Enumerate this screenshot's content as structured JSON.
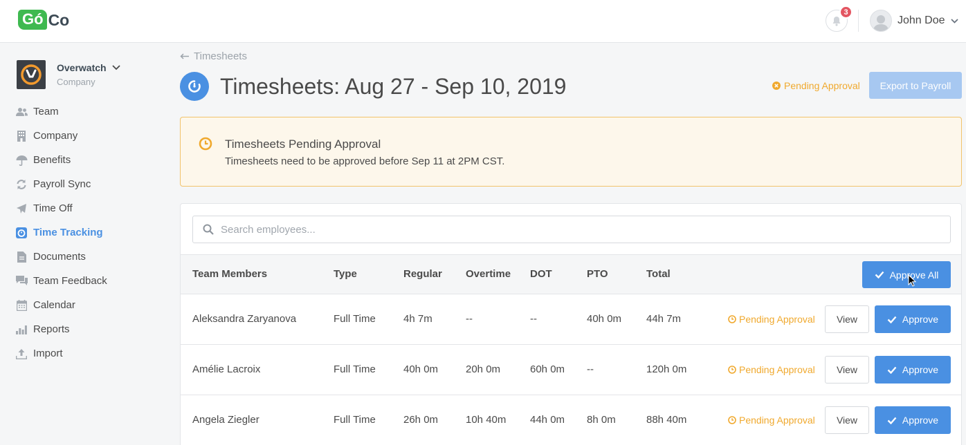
{
  "app": {
    "logo_go": "Gó",
    "logo_co": "Co",
    "notifications_count": "3",
    "user_name": "John Doe"
  },
  "org": {
    "name": "Overwatch",
    "subtitle": "Company"
  },
  "nav": [
    {
      "label": "Team",
      "icon": "team-icon",
      "active": false
    },
    {
      "label": "Company",
      "icon": "building-icon",
      "active": false
    },
    {
      "label": "Benefits",
      "icon": "umbrella-icon",
      "active": false
    },
    {
      "label": "Payroll Sync",
      "icon": "sync-icon",
      "active": false
    },
    {
      "label": "Time Off",
      "icon": "plane-icon",
      "active": false
    },
    {
      "label": "Time Tracking",
      "icon": "stopwatch-icon",
      "active": true
    },
    {
      "label": "Documents",
      "icon": "document-icon",
      "active": false
    },
    {
      "label": "Team Feedback",
      "icon": "feedback-icon",
      "active": false
    },
    {
      "label": "Calendar",
      "icon": "calendar-icon",
      "active": false
    },
    {
      "label": "Reports",
      "icon": "bar-chart-icon",
      "active": false
    },
    {
      "label": "Import",
      "icon": "upload-icon",
      "active": false
    }
  ],
  "header": {
    "back_label": "Timesheets",
    "title": "Timesheets: Aug 27 - Sep 10, 2019",
    "status": "Pending Approval",
    "export_label": "Export to Payroll"
  },
  "alert": {
    "title": "Timesheets Pending Approval",
    "text": "Timesheets need to be approved before Sep 11 at 2PM CST."
  },
  "search": {
    "placeholder": "Search employees..."
  },
  "table": {
    "columns": [
      "Team Members",
      "Type",
      "Regular",
      "Overtime",
      "DOT",
      "PTO",
      "Total"
    ],
    "approve_all_label": "Approve All",
    "view_label": "View",
    "approve_label": "Approve",
    "rows": [
      {
        "name": "Aleksandra Zaryanova",
        "type": "Full Time",
        "regular": "4h 7m",
        "overtime": "--",
        "dot": "--",
        "pto": "40h 0m",
        "total": "44h 7m",
        "status": "Pending Approval"
      },
      {
        "name": "Amélie Lacroix",
        "type": "Full Time",
        "regular": "40h 0m",
        "overtime": "20h 0m",
        "dot": "60h 0m",
        "pto": "--",
        "total": "120h 0m",
        "status": "Pending Approval"
      },
      {
        "name": "Angela Ziegler",
        "type": "Full Time",
        "regular": "26h 0m",
        "overtime": "10h 40m",
        "dot": "44h 0m",
        "pto": "8h 0m",
        "total": "88h 40m",
        "status": "Pending Approval"
      }
    ]
  },
  "colors": {
    "primary": "#4a90e2",
    "pending": "#f0a92e",
    "brand_green": "#3fb950",
    "badge": "#e35561"
  }
}
